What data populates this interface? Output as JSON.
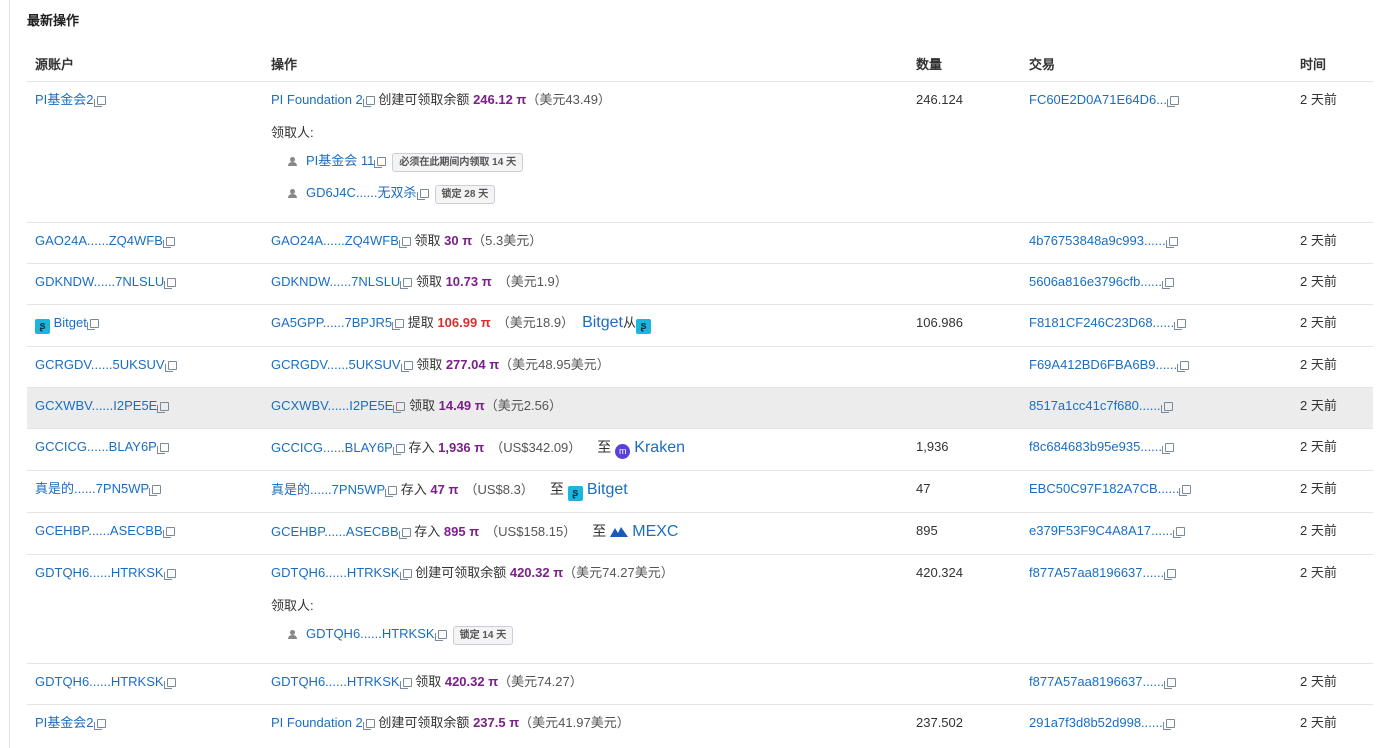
{
  "section_title": "最新操作",
  "headers": {
    "source": "源账户",
    "operation": "操作",
    "amount": "数量",
    "transaction": "交易",
    "time": "时间"
  },
  "labels": {
    "claimants": "领取人:",
    "create": "创建可领取余额",
    "claim": "领取",
    "withdraw": "提取",
    "deposit": "存入",
    "to": "至",
    "from": "从",
    "pi": "π"
  },
  "colors": {
    "link": "#1a6ec2",
    "amount": "#7b1f8a",
    "withdraw_amount": "#d9302b",
    "bitget": "#1cb5e0",
    "kraken": "#5741d9",
    "mexc": "#1a5ab8",
    "highlight_row": "#ececec"
  },
  "rows": [
    {
      "source": "PI基金会2",
      "op_account": "PI Foundation 2",
      "op_amount": "246.12 π",
      "op_fiat": "（美元43.49）",
      "amount": "246.124",
      "tx": "FC60E2D0A71E64D6...",
      "time": "2 天前",
      "claimants": [
        {
          "name": "PI基金会 11",
          "badge": "必须在此期间内领取 14 天"
        },
        {
          "name": "GD6J4C......无双杀",
          "badge": "锁定 28 天"
        }
      ]
    },
    {
      "source": "GAO24A......ZQ4WFB",
      "op_account": "GAO24A......ZQ4WFB",
      "op_amount": "30 π",
      "op_fiat": "（5.3美元）",
      "amount": "",
      "tx": "4b76753848a9c993......",
      "time": "2 天前"
    },
    {
      "source": "GDKNDW......7NLSLU",
      "op_account": "GDKNDW......7NLSLU",
      "op_amount": "10.73 π",
      "op_fiat": "（美元1.9）",
      "amount": "",
      "tx": "5606a816e3796cfb......",
      "time": "2 天前"
    },
    {
      "source": "Bitget",
      "op_account": "GA5GPP......7BPJR5",
      "op_amount": "106.99 π",
      "op_fiat": "（美元18.9）",
      "exchange": "Bitget",
      "amount": "106.986",
      "tx": "F8181CF246C23D68......",
      "time": "2 天前"
    },
    {
      "source": "GCRGDV......5UKSUV",
      "op_account": "GCRGDV......5UKSUV",
      "op_amount": "277.04 π",
      "op_fiat": "（美元48.95美元）",
      "amount": "",
      "tx": "F69A412BD6FBA6B9......",
      "time": "2 天前"
    },
    {
      "source": "GCXWBV......I2PE5E",
      "op_account": "GCXWBV......I2PE5E",
      "op_amount": "14.49 π",
      "op_fiat": "（美元2.56）",
      "amount": "",
      "tx": "8517a1cc41c7f680......",
      "time": "2 天前"
    },
    {
      "source": "GCCICG......BLAY6P",
      "op_account": "GCCICG......BLAY6P",
      "op_amount": "1,936 π",
      "op_fiat": "（US$342.09）",
      "exchange": "Kraken",
      "amount": "1,936",
      "tx": "f8c684683b95e935......",
      "time": "2 天前"
    },
    {
      "source": "真是的......7PN5WP",
      "op_account": "真是的......7PN5WP",
      "op_amount": "47 π",
      "op_fiat": "（US$8.3）",
      "exchange": "Bitget",
      "amount": "47",
      "tx": "EBC50C97F182A7CB......",
      "time": "2 天前"
    },
    {
      "source": "GCEHBP......ASECBB",
      "op_account": "GCEHBP......ASECBB",
      "op_amount": "895 π",
      "op_fiat": "（US$158.15）",
      "exchange": "MEXC",
      "amount": "895",
      "tx": "e379F53F9C4A8A17......",
      "time": "2 天前"
    },
    {
      "source": "GDTQH6......HTRKSK",
      "op_account": "GDTQH6......HTRKSK",
      "op_amount": "420.32 π",
      "op_fiat": "（美元74.27美元）",
      "amount": "420.324",
      "tx": "f877A57aa8196637......",
      "time": "2 天前",
      "claimants": [
        {
          "name": "GDTQH6......HTRKSK",
          "badge": "锁定 14 天"
        }
      ]
    },
    {
      "source": "GDTQH6......HTRKSK",
      "op_account": "GDTQH6......HTRKSK",
      "op_amount": "420.32 π",
      "op_fiat": "（美元74.27）",
      "amount": "",
      "tx": "f877A57aa8196637......",
      "time": "2 天前"
    },
    {
      "source": "PI基金会2",
      "op_account": "PI Foundation 2",
      "op_amount": "237.5 π",
      "op_fiat": "（美元41.97美元）",
      "amount": "237.502",
      "tx": "291a7f3d8b52d998......",
      "time": "2 天前"
    }
  ]
}
